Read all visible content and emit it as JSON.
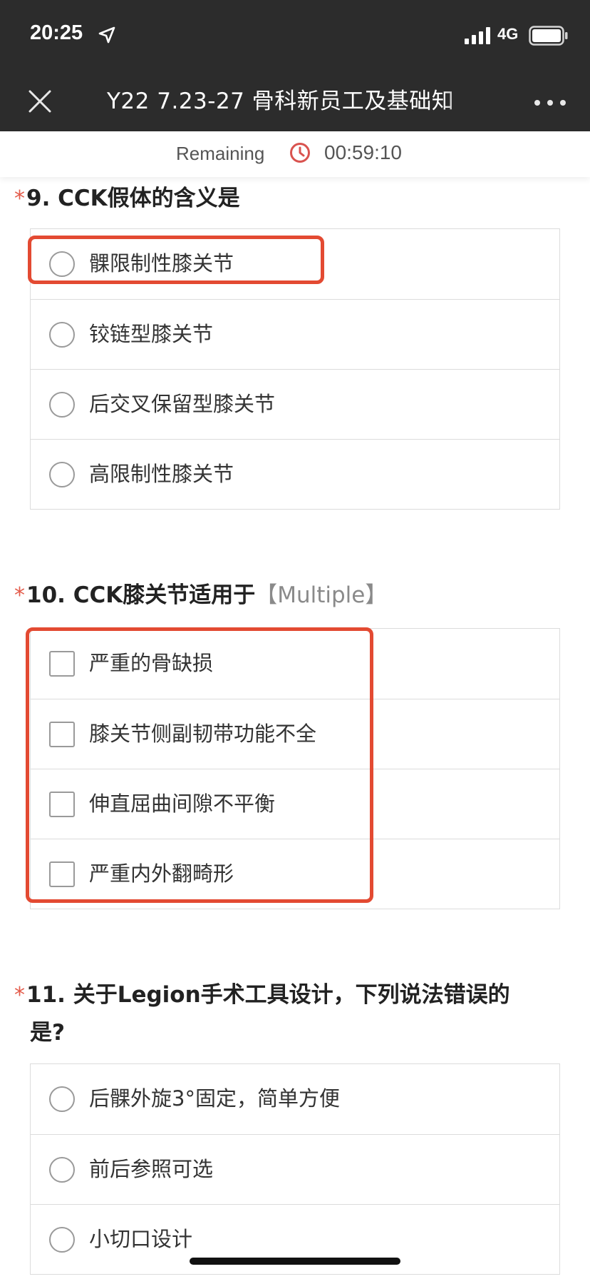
{
  "status_bar": {
    "time": "20:25",
    "network": "4G"
  },
  "header": {
    "title": "Y22 7.23-27 骨科新员工及基础知",
    "close_icon": "close-icon",
    "more_icon": "more-icon"
  },
  "timer": {
    "label": "Remaining",
    "value": "00:59:10",
    "icon_color": "#d9534f"
  },
  "questions": [
    {
      "required_mark": "*",
      "title": "9. CCK假体的含义是",
      "tag": "",
      "type": "single",
      "options": [
        {
          "label": "髁限制性膝关节"
        },
        {
          "label": "铰链型膝关节"
        },
        {
          "label": "后交叉保留型膝关节"
        },
        {
          "label": "高限制性膝关节"
        }
      ]
    },
    {
      "required_mark": "*",
      "title": "10. CCK膝关节适用于",
      "tag": "【Multiple】",
      "type": "multiple",
      "options": [
        {
          "label": "严重的骨缺损"
        },
        {
          "label": "膝关节侧副韧带功能不全"
        },
        {
          "label": "伸直屈曲间隙不平衡"
        },
        {
          "label": "严重内外翻畸形"
        }
      ]
    },
    {
      "required_mark": "*",
      "title_line1": "11. 关于Legion手术工具设计，下列说法错误的",
      "title_line2": "是?",
      "type": "single",
      "options": [
        {
          "label": "后髁外旋3°固定，简单方便"
        },
        {
          "label": "前后参照可选"
        },
        {
          "label": "小切口设计"
        }
      ]
    }
  ],
  "colors": {
    "header_bg": "#2c2c2c",
    "required_star": "#e35b4a",
    "annotation": "#e34a32"
  }
}
